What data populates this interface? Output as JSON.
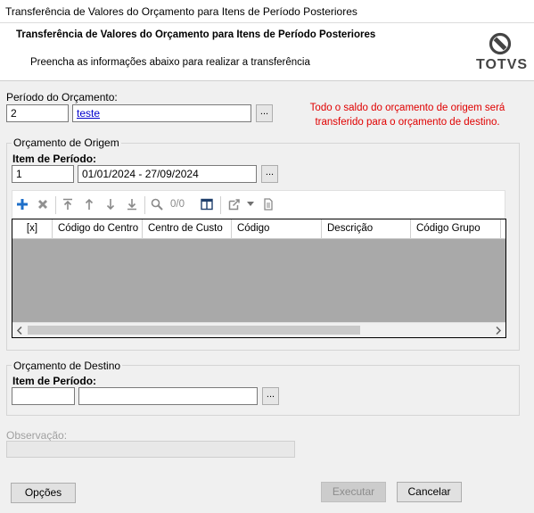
{
  "window": {
    "title": "Transferência de Valores do Orçamento para Itens de Período Posteriores"
  },
  "header": {
    "title": "Transferência de Valores do Orçamento para Itens de Período Posteriores",
    "subtitle": "Preencha as informações abaixo para realizar a transferência",
    "logo_text": "TOTVS"
  },
  "periodo": {
    "label": "Período do Orçamento:",
    "code": "2",
    "description": "teste",
    "lookup_label": "..."
  },
  "note": {
    "line1": "Todo o saldo do orçamento de origem será",
    "line2": "transferido para o orçamento de destino."
  },
  "origem": {
    "legend": "Orçamento de Origem",
    "item_label": "Item de Período:",
    "item_code": "1",
    "item_description": "01/01/2024 - 27/09/2024",
    "lookup_label": "...",
    "toolbar": {
      "page_counter": "0/0",
      "icons": [
        "add-icon",
        "delete-icon",
        "move-top-icon",
        "move-up-icon",
        "move-down-icon",
        "move-bottom-icon",
        "search-icon",
        "columns-icon",
        "export-icon",
        "document-icon"
      ]
    },
    "grid": {
      "columns": [
        "[x]",
        "Código do Centro",
        "Centro de Custo",
        "Código",
        "Descrição",
        "Código Grupo"
      ],
      "rows": []
    }
  },
  "destino": {
    "legend": "Orçamento de Destino",
    "item_label": "Item de Período:",
    "item_code": "",
    "item_description": "",
    "lookup_label": "..."
  },
  "observacao": {
    "label": "Observação:",
    "value": ""
  },
  "buttons": {
    "options": "Opções",
    "execute": "Executar",
    "cancel": "Cancelar"
  }
}
